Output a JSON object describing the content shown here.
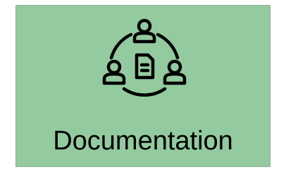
{
  "tile": {
    "label": "Documentation",
    "icon": "team-collaboration-document-icon",
    "background_color": "#94ca9f",
    "border_color": "#8fae95",
    "icon_color": "#000000",
    "text_color": "#000000"
  }
}
